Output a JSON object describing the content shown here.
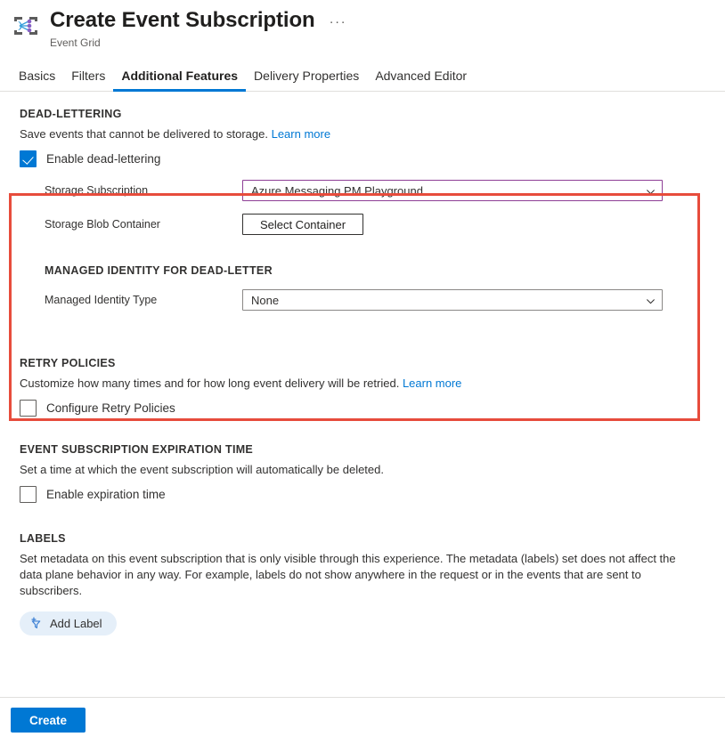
{
  "header": {
    "icon": "event-grid-icon",
    "title": "Create Event Subscription",
    "subtitle": "Event Grid",
    "more_label": "···"
  },
  "tabs": [
    {
      "label": "Basics",
      "active": false
    },
    {
      "label": "Filters",
      "active": false
    },
    {
      "label": "Additional Features",
      "active": true
    },
    {
      "label": "Delivery Properties",
      "active": false
    },
    {
      "label": "Advanced Editor",
      "active": false
    }
  ],
  "dead_lettering": {
    "section_title": "DEAD-LETTERING",
    "description": "Save events that cannot be delivered to storage.",
    "learn_more": "Learn more",
    "enable_label": "Enable dead-lettering",
    "enable_checked": true,
    "storage_subscription_label": "Storage Subscription",
    "storage_subscription_value": "Azure Messaging PM Playground",
    "storage_blob_container_label": "Storage Blob Container",
    "select_container_label": "Select Container",
    "managed_identity_section_title": "MANAGED IDENTITY FOR DEAD-LETTER",
    "managed_identity_type_label": "Managed Identity Type",
    "managed_identity_type_value": "None"
  },
  "retry_policies": {
    "section_title": "RETRY POLICIES",
    "description": "Customize how many times and for how long event delivery will be retried.",
    "learn_more": "Learn more",
    "checkbox_label": "Configure Retry Policies",
    "checked": false
  },
  "expiration": {
    "section_title": "EVENT SUBSCRIPTION EXPIRATION TIME",
    "description": "Set a time at which the event subscription will automatically be deleted.",
    "checkbox_label": "Enable expiration time",
    "checked": false
  },
  "labels": {
    "section_title": "LABELS",
    "description": "Set metadata on this event subscription that is only visible through this experience. The metadata (labels) set does not affect the data plane behavior in any way. For example, labels do not show anywhere in the request or in the events that are sent to subscribers.",
    "add_label_button": "Add Label",
    "add_label_icon": "filter-add-icon"
  },
  "footer": {
    "create_label": "Create"
  },
  "colors": {
    "accent": "#0078d4",
    "highlight_border": "#e74c3c",
    "focused_field_border": "#8e3f96",
    "pill_background": "#e5eff9"
  }
}
